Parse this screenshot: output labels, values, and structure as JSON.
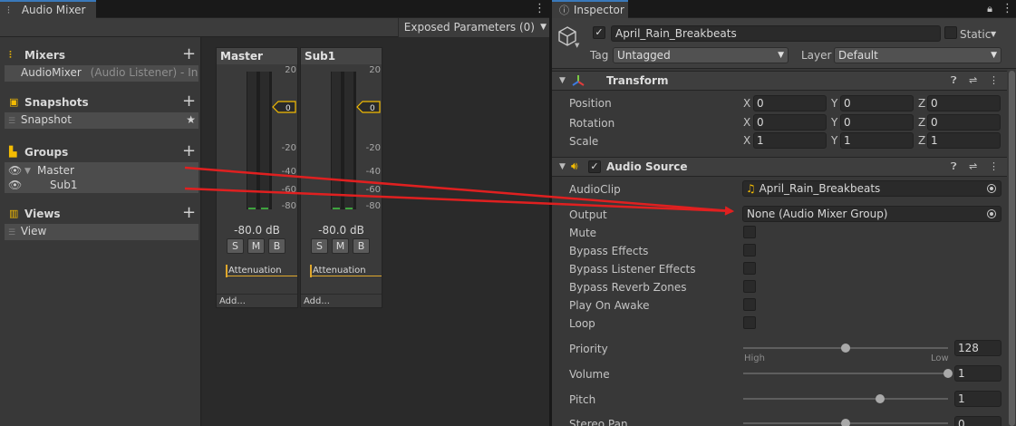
{
  "mixer_tab": {
    "label": "Audio Mixer",
    "icon": "mixer-sliders-icon"
  },
  "inspector_tab": {
    "label": "Inspector",
    "icon": "info-icon"
  },
  "mixer_toolbar": {
    "exposed_params": "Exposed Parameters (0)"
  },
  "sections": {
    "mixers": {
      "title": "Mixers",
      "item_name": "AudioMixer",
      "item_detail": "(Audio Listener) - Inac"
    },
    "snapshots": {
      "title": "Snapshots",
      "item": "Snapshot"
    },
    "groups": {
      "title": "Groups",
      "items": [
        "Master",
        "Sub1"
      ]
    },
    "views": {
      "title": "Views",
      "item": "View"
    }
  },
  "strips": [
    {
      "name": "Master",
      "db": "-80.0 dB",
      "fader_value": "0",
      "attenuation": "Attenuation",
      "add": "Add..."
    },
    {
      "name": "Sub1",
      "db": "-80.0 dB",
      "fader_value": "0",
      "attenuation": "Attenuation",
      "add": "Add..."
    }
  ],
  "scale_ticks": [
    "20",
    "0",
    "-20",
    "-40",
    "-60",
    "-80"
  ],
  "smb": [
    "S",
    "M",
    "B"
  ],
  "inspector": {
    "object_name": "April_Rain_Breakbeats",
    "static_label": "Static",
    "tag_label": "Tag",
    "tag_value": "Untagged",
    "layer_label": "Layer",
    "layer_value": "Default",
    "transform": {
      "title": "Transform",
      "rows": [
        {
          "label": "Position",
          "x": "0",
          "y": "0",
          "z": "0"
        },
        {
          "label": "Rotation",
          "x": "0",
          "y": "0",
          "z": "0"
        },
        {
          "label": "Scale",
          "x": "1",
          "y": "1",
          "z": "1"
        }
      ],
      "axes": [
        "X",
        "Y",
        "Z"
      ]
    },
    "audio_source": {
      "title": "Audio Source",
      "audioclip_label": "AudioClip",
      "audioclip_value": "April_Rain_Breakbeats",
      "output_label": "Output",
      "output_value": "None (Audio Mixer Group)",
      "toggles": [
        "Mute",
        "Bypass Effects",
        "Bypass Listener Effects",
        "Bypass Reverb Zones",
        "Play On Awake",
        "Loop"
      ],
      "priority_label": "Priority",
      "priority_value": "128",
      "priority_fraction": 0.5,
      "priority_high": "High",
      "priority_low": "Low",
      "volume_label": "Volume",
      "volume_value": "1",
      "volume_fraction": 1.0,
      "pitch_label": "Pitch",
      "pitch_value": "1",
      "pitch_fraction": 0.67,
      "stereo_label": "Stereo Pan",
      "stereo_value": "0",
      "stereo_fraction": 0.5
    }
  },
  "colors": {
    "accent_yellow": "#f4bc02",
    "arrow_red": "#e02020",
    "tab_blue": "#3a79bb"
  }
}
